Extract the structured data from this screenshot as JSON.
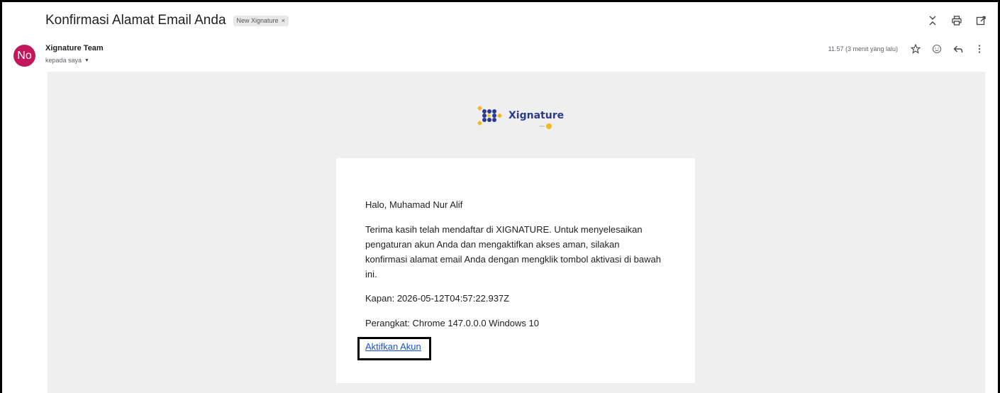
{
  "email": {
    "subject": "Konfirmasi Alamat Email Anda",
    "label": "New Xignature",
    "label_close": "×"
  },
  "toolbar": {
    "icons": [
      "expand-collapse-icon",
      "print-icon",
      "open-new-window-icon"
    ]
  },
  "sender": {
    "avatar_initials": "No",
    "avatar_color": "#c2185b",
    "name": "Xignature Team",
    "recipient": "kepada saya",
    "timestamp": "11.57 (3 menit yang lalu)"
  },
  "message": {
    "brand_name": "Xignature",
    "brand_color": "#2b3a8f",
    "greeting": "Halo, Muhamad Nur Alif",
    "body": "Terima kasih telah mendaftar di XIGNATURE. Untuk menyelesaikan pengaturan akun Anda dan mengaktifkan akses aman, silakan konfirmasi alamat email Anda dengan mengklik tombol aktivasi di bawah ini.",
    "when": "Kapan: 2026-05-12T04:57:22.937Z",
    "device": "Perangkat: Chrome 147.0.0.0 Windows 10",
    "activate_label": "Aktifkan Akun",
    "link_color": "#1a4fd6"
  }
}
